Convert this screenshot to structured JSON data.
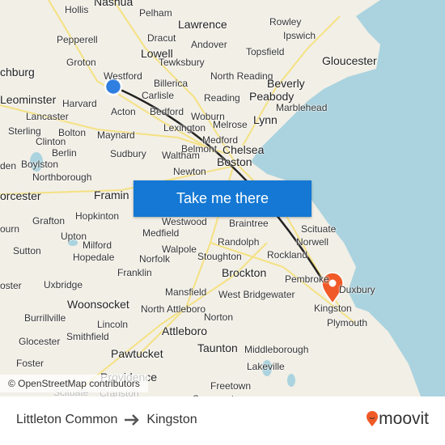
{
  "map": {
    "cta_label": "Take me there",
    "attribution": "© OpenStreetMap contributors",
    "colors": {
      "land": "#f2efe6",
      "water": "#aad3df",
      "route": "#222222",
      "origin": "#2f7fe0",
      "destination": "#f05a28",
      "button": "#1478d4"
    },
    "towns": [
      "Nashua",
      "Hollis",
      "Pelham",
      "Lawrence",
      "Rowley",
      "Ipswich",
      "Pepperell",
      "Dracut",
      "Andover",
      "Topsfield",
      "Lowell",
      "Tewksbury",
      "Gloucester",
      "Groton",
      "chburg",
      "Westford",
      "North Reading",
      "Beverly",
      "Billerica",
      "Reading",
      "Peabody",
      "Leominster",
      "Harvard",
      "Carlisle",
      "Marblehead",
      "Acton",
      "Bedford",
      "Woburn",
      "Lynn",
      "Lancaster",
      "Lexington",
      "Melrose",
      "Sterling",
      "Bolton",
      "Maynard",
      "Medford",
      "Clinton",
      "Chelsea",
      "Belmont",
      "Berlin",
      "Sudbury",
      "Waltham",
      "Boston",
      "den",
      "Boylston",
      "Northborough",
      "Newton",
      "orcester",
      "Framin",
      "Grafton",
      "Hopkinton",
      "Westwood",
      "Braintree",
      "Scituate",
      "Upton",
      "Medfield",
      "Randolph",
      "Norwell",
      "ourn",
      "Milford",
      "Walpole",
      "Stoughton",
      "Rockland",
      "Sutton",
      "Hopedale",
      "Norfolk",
      "Franklin",
      "Brockton",
      "Pembroke",
      "oster",
      "Uxbridge",
      "Mansfield",
      "West Bridgewater",
      "Duxbury",
      "Woonsocket",
      "North Attleboro",
      "Kingston",
      "Burrillville",
      "Lincoln",
      "Norton",
      "Plymouth",
      "Smithfield",
      "Glocester",
      "Attleboro",
      "Taunton",
      "Middleborough",
      "Pawtucket",
      "Foster",
      "Lakeville",
      "Providence",
      "Freetown",
      "Scituate",
      "Cranston",
      "Somerset"
    ]
  },
  "footer": {
    "origin": "Littleton Common",
    "arrow_icon": "arrow-right-icon",
    "destination": "Kingston",
    "logo": "moovit"
  }
}
